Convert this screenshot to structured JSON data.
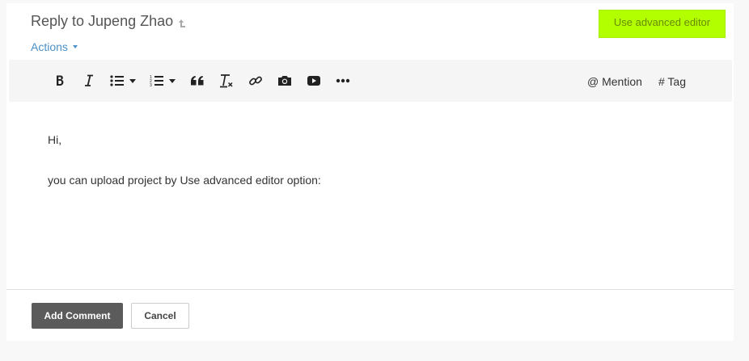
{
  "header": {
    "title": "Reply to Jupeng Zhao",
    "title_icon": "reply-arrow-icon",
    "advanced_editor_label": "Use advanced editor",
    "actions_label": "Actions"
  },
  "toolbar": {
    "buttons": [
      {
        "name": "bold",
        "icon": "bold-icon"
      },
      {
        "name": "italic",
        "icon": "italic-icon"
      },
      {
        "name": "bulleted-list",
        "icon": "bulleted-list-icon"
      },
      {
        "name": "numbered-list",
        "icon": "numbered-list-icon"
      },
      {
        "name": "blockquote",
        "icon": "quote-icon"
      },
      {
        "name": "remove-format",
        "icon": "clear-format-icon"
      },
      {
        "name": "link",
        "icon": "link-icon"
      },
      {
        "name": "photo",
        "icon": "camera-icon"
      },
      {
        "name": "video",
        "icon": "video-icon"
      },
      {
        "name": "more",
        "icon": "more-icon"
      }
    ],
    "mention_label": "@ Mention",
    "tag_label": "# Tag"
  },
  "editor": {
    "lines": [
      "Hi,",
      "you can upload project by Use advanced editor option:"
    ]
  },
  "footer": {
    "add_comment_label": "Add Comment",
    "cancel_label": "Cancel"
  },
  "colors": {
    "highlight_button": "#b2ff00",
    "link_blue": "#4a90c8",
    "primary_button": "#5b5b5b"
  }
}
